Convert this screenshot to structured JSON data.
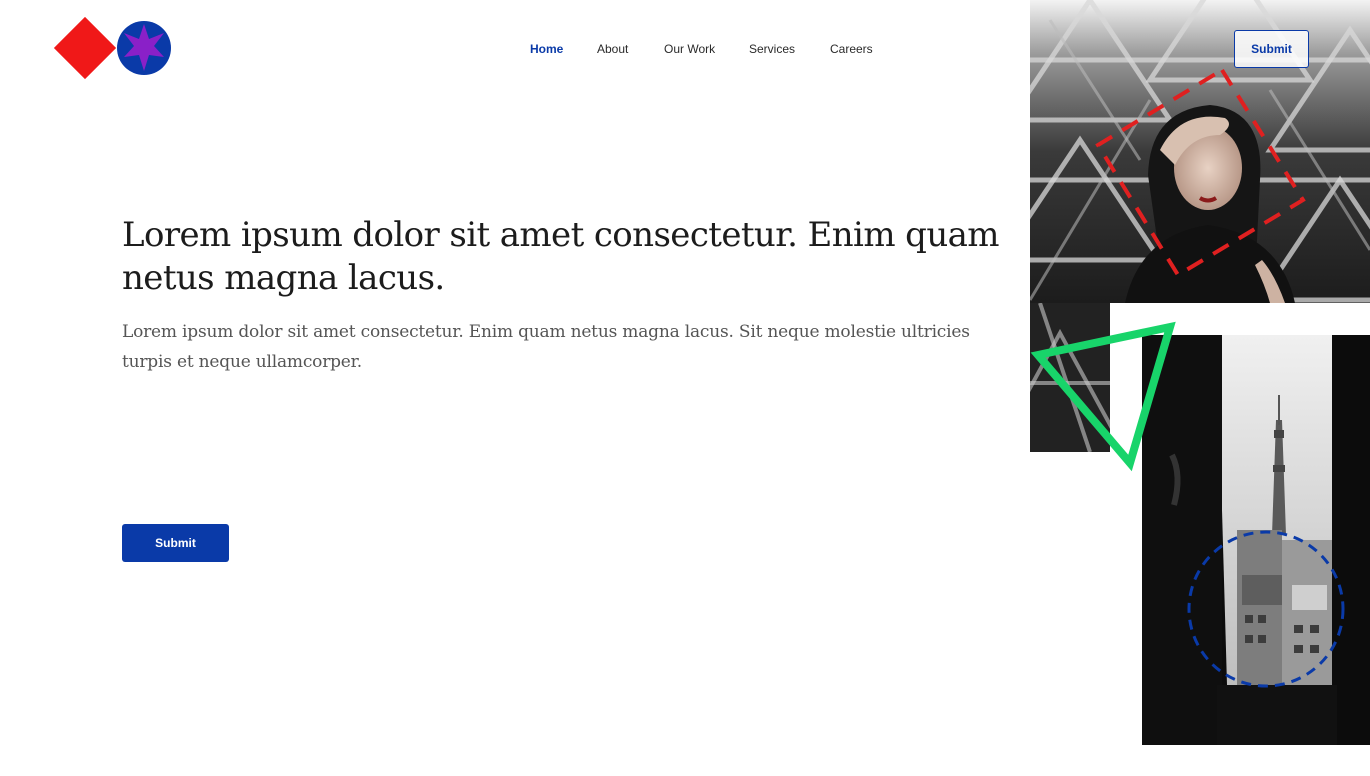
{
  "header": {
    "logo_name": "brand-logo",
    "nav": [
      {
        "label": "Home",
        "active": true
      },
      {
        "label": "About",
        "active": false
      },
      {
        "label": "Our Work",
        "active": false
      },
      {
        "label": "Services",
        "active": false
      },
      {
        "label": "Careers",
        "active": false
      }
    ],
    "cta_label": "Submit"
  },
  "hero": {
    "title": "Lorem ipsum dolor sit amet consectetur. Enim quam netus magna lacus.",
    "subtitle": "Lorem ipsum dolor sit amet consectetur. Enim quam netus magna lacus. Sit neque molestie ultricies turpis et neque ullamcorper.",
    "button_label": "Submit"
  },
  "colors": {
    "primary": "#0a3aa8",
    "accent_red": "#f01818",
    "accent_purple": "#8a20c8",
    "accent_green": "#18d46a"
  },
  "images": {
    "top": "woman-portrait-photo",
    "bottom": "city-tower-photo"
  }
}
